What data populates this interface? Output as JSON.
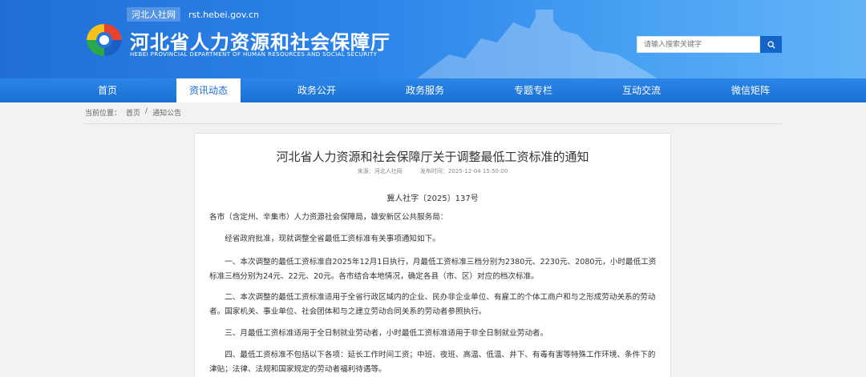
{
  "header": {
    "site_tag": "河北人社网",
    "site_url": "rst.hebei.gov.cn",
    "title_cn": "河北省人力资源和社会保障厅",
    "title_en": "HEBEI PROVINCIAL DEPARTMENT OF HUMAN RESOURCES AND SOCIAL SECURITY",
    "search_placeholder": "请输入搜索关键字",
    "colors": {
      "primary": "#1f6fd6",
      "search_button": "#1463c9"
    }
  },
  "nav": {
    "items": [
      {
        "label": "首页"
      },
      {
        "label": "资讯动态"
      },
      {
        "label": "政务公开"
      },
      {
        "label": "政务服务"
      },
      {
        "label": "专题专栏"
      },
      {
        "label": "互动交流"
      },
      {
        "label": "微信矩阵"
      }
    ],
    "active": "资讯动态"
  },
  "breadcrumb": {
    "prefix": "当前位置：",
    "items": [
      "首页",
      "/",
      "通知公告"
    ]
  },
  "article": {
    "title": "河北省人力资源和社会保障厅关于调整最低工资标准的通知",
    "source": "来源：河北人社网",
    "published": "发布时间：2025-12-04 15:50:00",
    "doc_number": "冀人社字〔2025〕137号",
    "addressee": "各市（含定州、辛集市）人力资源社会保障局，雄安新区公共服务局：",
    "paragraphs": [
      "经省政府批准，现就调整全省最低工资标准有关事项通知如下。",
      "一、本次调整的最低工资标准自2025年12月1日执行，月最低工资标准三档分别为2380元、2230元、2080元，小时最低工资标准三档分别为24元、22元、20元。各市结合本地情况，确定各县（市、区）对应的档次标准。",
      "二、本次调整的最低工资标准适用于全省行政区域内的企业、民办非企业单位、有雇工的个体工商户和与之形成劳动关系的劳动者。国家机关、事业单位、社会团体和与之建立劳动合同关系的劳动者参照执行。",
      "三、月最低工资标准适用于全日制就业劳动者，小时最低工资标准适用于非全日制就业劳动者。",
      "四、最低工资标准不包括以下各项：延长工作时间工资；中班、夜班、高温、低温、井下、有毒有害等特殊工作环境、条件下的津贴；法律、法规和国家规定的劳动者福利待遇等。"
    ]
  }
}
